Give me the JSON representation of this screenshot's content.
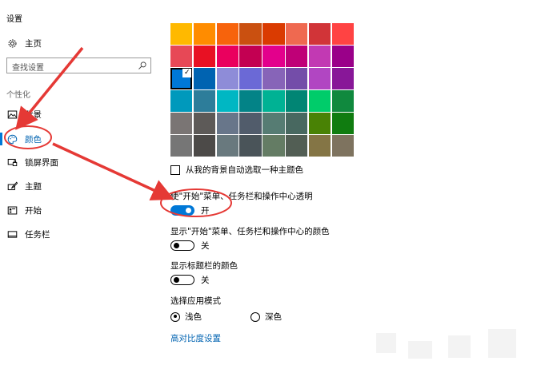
{
  "app": {
    "title": "设置"
  },
  "sidebar": {
    "home_label": "主页",
    "search_placeholder": "查找设置",
    "section_label": "个性化",
    "items": [
      {
        "label": "背景",
        "icon": "picture-icon"
      },
      {
        "label": "颜色",
        "icon": "palette-icon",
        "active": true
      },
      {
        "label": "锁屏界面",
        "icon": "lock-screen-icon"
      },
      {
        "label": "主题",
        "icon": "brush-icon"
      },
      {
        "label": "开始",
        "icon": "start-icon"
      },
      {
        "label": "任务栏",
        "icon": "taskbar-icon"
      }
    ]
  },
  "colors": {
    "accent": "#0078d7",
    "swatches": [
      "#ffb900",
      "#ff8c00",
      "#f7630c",
      "#ca5010",
      "#da3b01",
      "#ef6950",
      "#d13438",
      "#ff4343",
      "#e74856",
      "#e81123",
      "#ea005e",
      "#c30052",
      "#e3008c",
      "#bf0077",
      "#c239b3",
      "#9a0089",
      "#0078d7",
      "#0063b1",
      "#8e8cd8",
      "#6b69d6",
      "#8764b8",
      "#744da9",
      "#b146c2",
      "#881798",
      "#0099bc",
      "#2d7d9a",
      "#00b7c3",
      "#038387",
      "#00b294",
      "#018574",
      "#00cc6a",
      "#10893e",
      "#7a7574",
      "#5d5a58",
      "#68768a",
      "#515c6b",
      "#567c73",
      "#486860",
      "#498205",
      "#107c10",
      "#767676",
      "#4c4a48",
      "#69797e",
      "#4a5459",
      "#647c64",
      "#525e54",
      "#847545",
      "#7e735f"
    ],
    "selected_index": 16,
    "check_mark": "✓"
  },
  "settings": {
    "auto_pick_label": "从我的背景自动选取一种主题色",
    "transparency": {
      "label": "使\"开始\"菜单、任务栏和操作中心透明",
      "state": "开",
      "on": true
    },
    "show_color_start": {
      "label": "显示\"开始\"菜单、任务栏和操作中心的颜色",
      "state": "关",
      "on": false
    },
    "show_title_bar": {
      "label": "显示标题栏的颜色",
      "state": "关",
      "on": false
    },
    "app_mode": {
      "label": "选择应用模式",
      "light": "浅色",
      "dark": "深色",
      "selected": "light"
    },
    "high_contrast_link": "高对比度设置"
  }
}
